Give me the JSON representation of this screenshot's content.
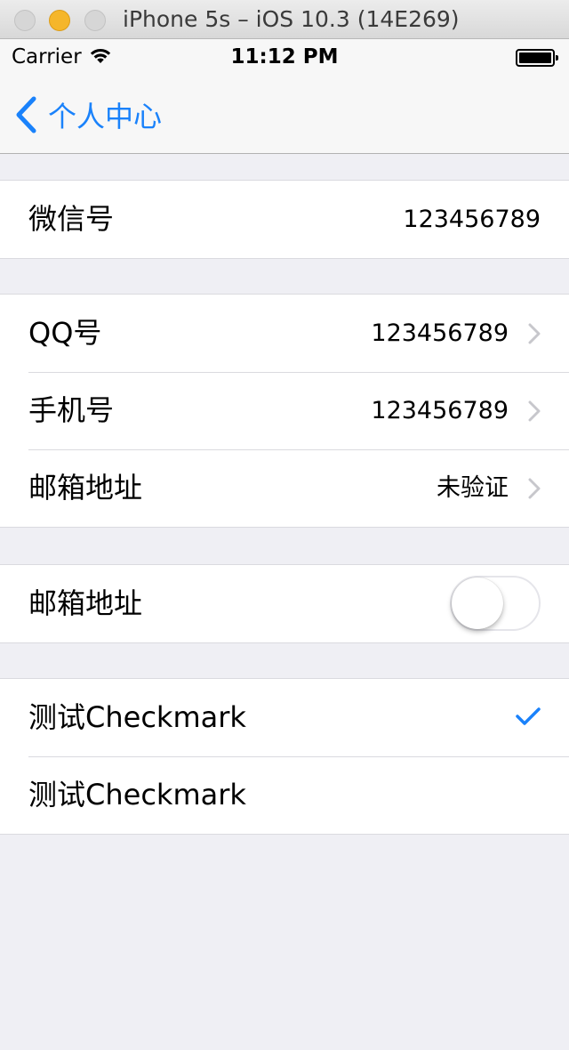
{
  "window": {
    "title": "iPhone 5s – iOS 10.3 (14E269)"
  },
  "status_bar": {
    "carrier": "Carrier",
    "time": "11:12 PM"
  },
  "nav": {
    "back_label": "个人中心"
  },
  "section1": {
    "row1": {
      "label": "微信号",
      "value": "123456789"
    }
  },
  "section2": {
    "row1": {
      "label": "QQ号",
      "value": "123456789"
    },
    "row2": {
      "label": "手机号",
      "value": "123456789"
    },
    "row3": {
      "label": "邮箱地址",
      "value": "未验证"
    }
  },
  "section3": {
    "row1": {
      "label": "邮箱地址",
      "switch_on": false
    }
  },
  "section4": {
    "row1": {
      "label": "测试Checkmark",
      "checked": true
    },
    "row2": {
      "label": "测试Checkmark",
      "checked": false
    }
  },
  "colors": {
    "tint": "#1a82fb",
    "background": "#efeff4",
    "separator": "#dadadf",
    "chevron": "#c7c7cc"
  },
  "icons": [
    "wifi-icon",
    "battery-icon",
    "back-chevron-icon",
    "disclosure-chevron-icon",
    "checkmark-icon"
  ]
}
